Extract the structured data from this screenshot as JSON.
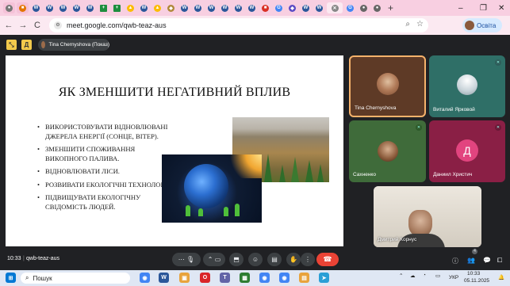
{
  "browser": {
    "tabs_note": "",
    "new_tab_label": "+",
    "win_minimize": "–",
    "win_restore": "❐",
    "win_close": "✕",
    "nav_back": "←",
    "nav_forward": "→",
    "nav_reload": "C",
    "url": "meet.google.com/qwb-teaz-aus",
    "profile_label": "Освіта"
  },
  "meet": {
    "presenter_label": "Tina Chernyshova (Показ)",
    "clock": "10:33",
    "separator": "|",
    "meeting_code": "qwb-teaz-aus",
    "hand_count": "4"
  },
  "slide": {
    "title": "ЯК ЗМЕНШИТИ НЕГАТИВНИЙ ВПЛИВ",
    "bullets": [
      "ВИКОРИСТОВУВАТИ ВІДНОВЛЮВАНІ ДЖЕРЕЛА ЕНЕРГІЇ (СОНЦЕ, ВІТЕР).",
      "ЗМЕНШИТИ СПОЖИВАННЯ ВИКОПНОГО ПАЛИВА.",
      "ВІДНОВЛЮВАТИ ЛІСИ.",
      "РОЗВИВАТИ ЕКОЛОГІЧНІ ТЕХНОЛОГІЇ.",
      "ПІДВИЩУВАТИ ЕКОЛОГІЧНУ СВІДОМІСТЬ ЛЮДЕЙ."
    ]
  },
  "participants": [
    {
      "name": "Tina Chernyshova"
    },
    {
      "name": "Виталий Ярковой"
    },
    {
      "name": "Сахненко"
    },
    {
      "name": "Даниил Христич",
      "initial": "Д"
    },
    {
      "name": "Дмитрий Корнус"
    }
  ],
  "taskbar": {
    "search_placeholder": "Пошук",
    "lang": "УКР",
    "time": "10:33",
    "date": "05.11.2025"
  },
  "colors": {
    "meet_bg": "#202124",
    "active_speaker_border": "#f6b26b",
    "end_call": "#ea4335",
    "tab_strip": "#f8cfe1"
  }
}
